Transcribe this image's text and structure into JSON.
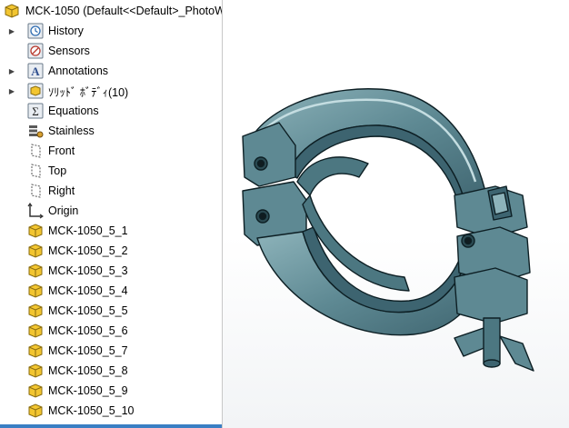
{
  "root": {
    "label": "MCK-1050  (Default<<Default>_PhotoW"
  },
  "tree_items": [
    {
      "label": "History",
      "icon": "history-icon",
      "expandable": true
    },
    {
      "label": "Sensors",
      "icon": "sensors-icon",
      "expandable": false
    },
    {
      "label": "Annotations",
      "icon": "annotations-icon",
      "expandable": true
    },
    {
      "label": "ｿﾘｯﾄﾞ ﾎﾞﾃﾞｨ(10)",
      "icon": "solid-bodies-icon",
      "expandable": true
    },
    {
      "label": "Equations",
      "icon": "equations-icon",
      "expandable": false
    },
    {
      "label": "Stainless",
      "icon": "material-icon",
      "expandable": false
    },
    {
      "label": "Front",
      "icon": "plane-icon",
      "expandable": false
    },
    {
      "label": "Top",
      "icon": "plane-icon",
      "expandable": false
    },
    {
      "label": "Right",
      "icon": "plane-icon",
      "expandable": false
    },
    {
      "label": "Origin",
      "icon": "origin-icon",
      "expandable": false
    },
    {
      "label": "MCK-1050_5_1",
      "icon": "part-icon",
      "expandable": false
    },
    {
      "label": "MCK-1050_5_2",
      "icon": "part-icon",
      "expandable": false
    },
    {
      "label": "MCK-1050_5_3",
      "icon": "part-icon",
      "expandable": false
    },
    {
      "label": "MCK-1050_5_4",
      "icon": "part-icon",
      "expandable": false
    },
    {
      "label": "MCK-1050_5_5",
      "icon": "part-icon",
      "expandable": false
    },
    {
      "label": "MCK-1050_5_6",
      "icon": "part-icon",
      "expandable": false
    },
    {
      "label": "MCK-1050_5_7",
      "icon": "part-icon",
      "expandable": false
    },
    {
      "label": "MCK-1050_5_8",
      "icon": "part-icon",
      "expandable": false
    },
    {
      "label": "MCK-1050_5_9",
      "icon": "part-icon",
      "expandable": false
    },
    {
      "label": "MCK-1050_5_10",
      "icon": "part-icon",
      "expandable": false
    }
  ],
  "colors": {
    "model_fill": "#5e8993",
    "model_shade": "#3d6470",
    "model_highlight": "#9cc1c8",
    "edge": "#0d1f24",
    "part_icon": "#f2c530",
    "selection_bar": "#3a7fc4"
  }
}
